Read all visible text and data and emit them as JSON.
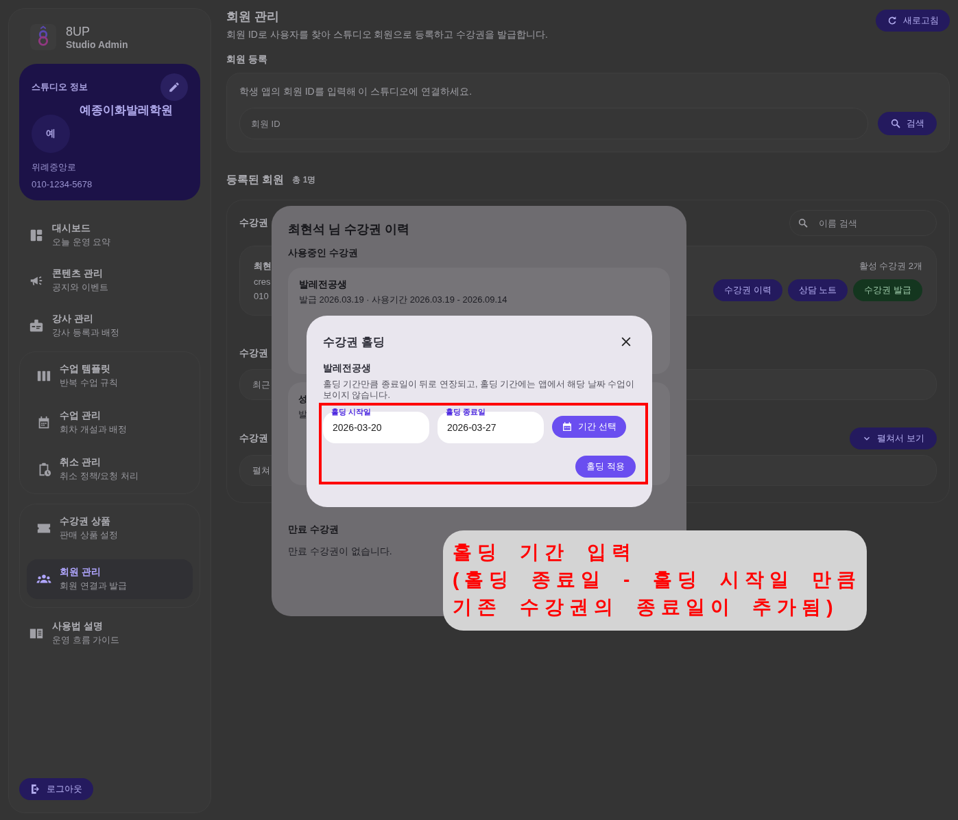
{
  "sidebar": {
    "brand": {
      "name": "8UP",
      "subtitle": "Studio Admin"
    },
    "studio_card": {
      "heading": "스튜디오 정보",
      "avatar": "예",
      "name": "예종이화발레학원",
      "address": "위례중앙로",
      "phone": "010-1234-5678"
    },
    "nav_groups": [
      {
        "boxed": false,
        "items": [
          {
            "title": "대시보드",
            "subtitle": "오늘 운영 요약",
            "selected": false
          },
          {
            "title": "콘텐츠 관리",
            "subtitle": "공지와 이벤트",
            "selected": false
          },
          {
            "title": "강사 관리",
            "subtitle": "강사 등록과 배정",
            "selected": false
          }
        ]
      },
      {
        "boxed": true,
        "items": [
          {
            "title": "수업 템플릿",
            "subtitle": "반복 수업 규칙",
            "selected": false
          },
          {
            "title": "수업 관리",
            "subtitle": "회차 개설과 배정",
            "selected": false
          },
          {
            "title": "취소 관리",
            "subtitle": "취소 정책/요청 처리",
            "selected": false
          }
        ]
      },
      {
        "boxed": true,
        "items": [
          {
            "title": "수강권 상품",
            "subtitle": "판매 상품 설정",
            "selected": false
          },
          {
            "title": "회원 관리",
            "subtitle": "회원 연결과 발급",
            "selected": true
          }
        ]
      },
      {
        "boxed": false,
        "items": [
          {
            "title": "사용법 설명",
            "subtitle": "운영 흐름 가이드",
            "selected": false
          }
        ]
      }
    ],
    "logout": "로그아웃"
  },
  "header": {
    "title": "회원 관리",
    "subtitle": "회원 ID로 사용자를 찾아 스튜디오 회원으로 등록하고 수강권을 발급합니다.",
    "refresh": "새로고침"
  },
  "register": {
    "heading": "회원 등록",
    "hint": "학생 앱의 회원 ID를 입력해 이 스튜디오에 연결하세요.",
    "input": {
      "placeholder": "회원 ID"
    },
    "search_button": "검색"
  },
  "members": {
    "heading": "등록된 회원",
    "count": "총 1명",
    "section_label": "수강권",
    "search": {
      "placeholder": "이름 검색"
    },
    "member": {
      "name": "최현",
      "id": "cres",
      "phone": "010",
      "active_count": "활성 수강권 2개",
      "actions": [
        {
          "label": "수강권 이력",
          "kind": "primary"
        },
        {
          "label": "상담 노트",
          "kind": "primary"
        },
        {
          "label": "수강권 발급",
          "kind": "success"
        }
      ]
    },
    "sections": [
      {
        "label": "수강권",
        "row": "최근"
      },
      {
        "label": "수강권",
        "row": "펼쳐",
        "toggle": "펼쳐서 보기"
      }
    ]
  },
  "history_modal": {
    "title": "최현석 님 수강권 이력",
    "active_heading": "사용중인 수강권",
    "passes": [
      {
        "name": "발레전공생",
        "meta": "발급 2026.03.19 · 사용기간 2026.03.19 - 2026.09.14"
      },
      {
        "name": "성",
        "meta": "발"
      }
    ],
    "expired_heading": "만료 수강권",
    "expired_empty": "만료 수강권이 없습니다."
  },
  "holding_dialog": {
    "title": "수강권 홀딩",
    "pass_name": "발레전공생",
    "description": "홀딩 기간만큼 종료일이 뒤로 연장되고, 홀딩 기간에는 앱에서 해당 날짜 수업이 보이지 않습니다.",
    "fields": [
      {
        "label": "홀딩 시작일",
        "value": "2026-03-20"
      },
      {
        "label": "홀딩 종료일",
        "value": "2026-03-27"
      }
    ],
    "range_button": "기간 선택",
    "apply_button": "홀딩 적용"
  },
  "annotation": {
    "lines": [
      "홀딩 기간 입력",
      "(홀딩 종료일 - 홀딩 시작일 만큼",
      "기존 수강권의 종료일이 추가됨)"
    ]
  }
}
